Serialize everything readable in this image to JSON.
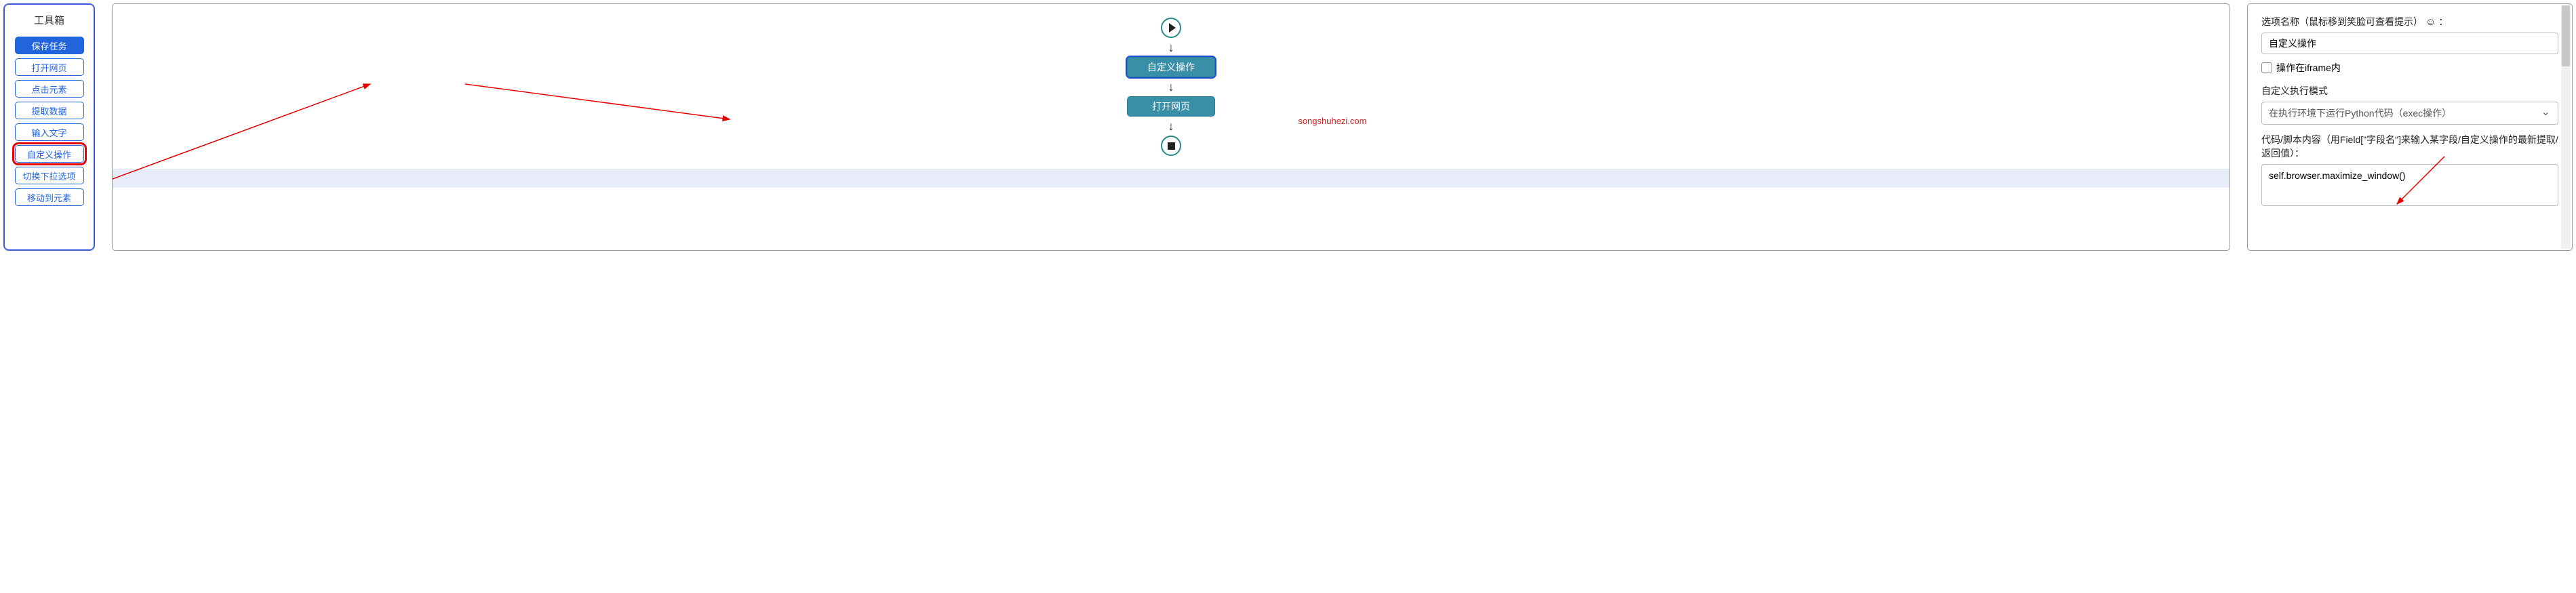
{
  "toolbox": {
    "title": "工具箱",
    "buttons": [
      {
        "label": "保存任务",
        "type": "primary"
      },
      {
        "label": "打开网页",
        "type": "outline"
      },
      {
        "label": "点击元素",
        "type": "outline"
      },
      {
        "label": "提取数据",
        "type": "outline"
      },
      {
        "label": "输入文字",
        "type": "outline"
      },
      {
        "label": "自定义操作",
        "type": "outline",
        "highlighted": true
      },
      {
        "label": "切换下拉选项",
        "type": "outline"
      },
      {
        "label": "移动到元素",
        "type": "outline"
      }
    ]
  },
  "canvas": {
    "watermark": "songshuhezi.com",
    "nodes": [
      {
        "label": "自定义操作",
        "selected": true
      },
      {
        "label": "打开网页",
        "selected": false
      }
    ]
  },
  "properties": {
    "option_name_label": "选项名称（鼠标移到笑脸可查看提示）",
    "option_name_value": "自定义操作",
    "iframe_label": "操作在iframe内",
    "iframe_checked": false,
    "mode_label": "自定义执行模式",
    "mode_value": "在执行环境下运行Python代码（exec操作）",
    "code_label": "代码/脚本内容（用Field[\"字段名\"]来输入某字段/自定义操作的最新提取/返回值）：",
    "code_value": "self.browser.maximize_window()"
  }
}
